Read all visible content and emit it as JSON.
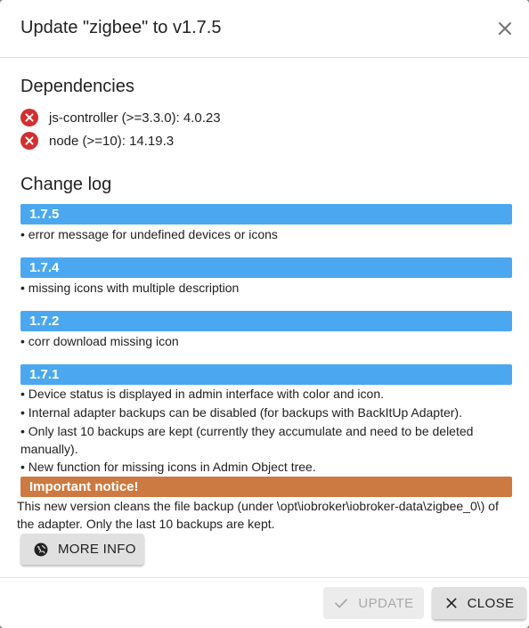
{
  "dialog": {
    "title": "Update \"zigbee\" to v1.7.5"
  },
  "dependencies": {
    "heading": "Dependencies",
    "items": [
      {
        "text": "js-controller (>=3.3.0): 4.0.23",
        "status": "error"
      },
      {
        "text": "node (>=10): 14.19.3",
        "status": "error"
      }
    ]
  },
  "changelog": {
    "heading": "Change log",
    "versions": [
      {
        "version": "1.7.5",
        "lines": [
          "• error message for undefined devices or icons"
        ]
      },
      {
        "version": "1.7.4",
        "lines": [
          "• missing icons with multiple description"
        ]
      },
      {
        "version": "1.7.2",
        "lines": [
          "• corr download missing icon"
        ]
      },
      {
        "version": "1.7.1",
        "lines": [
          "• Device status is displayed in admin interface with color and icon.",
          "• Internal adapter backups can be disabled (for backups with BackItUp Adapter).",
          "• Only last 10 backups are kept (currently they accumulate and need to be deleted manually).",
          "• New function for missing icons in Admin Object tree."
        ]
      }
    ]
  },
  "notice": {
    "heading": "Important notice!",
    "text": "This new version cleans the file backup (under \\opt\\iobroker\\iobroker-data\\zigbee_0\\) of the adapter. Only the last 10 backups are kept.",
    "more_info_label": "MORE INFO"
  },
  "footer": {
    "update_label": "UPDATE",
    "close_label": "CLOSE"
  },
  "colors": {
    "version_bar": "#4ba8f0",
    "notice_bar": "#cc7a42",
    "error_icon": "#d32f2f"
  },
  "icons": {
    "dependency_status": "error-circle-icon",
    "close": "close-icon",
    "more_info": "globe-icon",
    "update": "check-icon",
    "close_button": "close-icon"
  }
}
